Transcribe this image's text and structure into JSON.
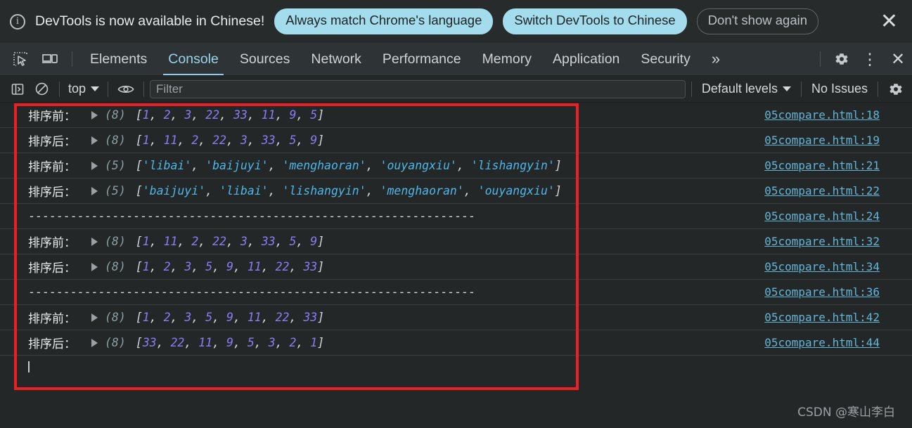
{
  "banner": {
    "info_icon": "info-icon",
    "message": "DevTools is now available in Chinese!",
    "primary_button": "Always match Chrome's language",
    "secondary_button": "Switch DevTools to Chinese",
    "dismiss_button": "Don't show again",
    "close_icon": "✕",
    "accent_color": "#a3dcec"
  },
  "tabbar": {
    "inspect_icon": "inspect-element-icon",
    "device_icon": "device-toolbar-icon",
    "tabs": [
      {
        "label": "Elements",
        "active": false
      },
      {
        "label": "Console",
        "active": true
      },
      {
        "label": "Sources",
        "active": false
      },
      {
        "label": "Network",
        "active": false
      },
      {
        "label": "Performance",
        "active": false
      },
      {
        "label": "Memory",
        "active": false
      },
      {
        "label": "Application",
        "active": false
      },
      {
        "label": "Security",
        "active": false
      }
    ],
    "more_tabs_icon": "»",
    "settings_icon": "gear-icon",
    "menu_icon": "⋮",
    "close_icon": "✕",
    "active_tab_color": "#9ad4ec"
  },
  "console_toolbar": {
    "sidebar_toggle_icon": "sidebar-toggle-icon",
    "clear_console_icon": "clear-console-icon",
    "context": "top",
    "eye_icon": "live-expression-icon",
    "filter_placeholder": "Filter",
    "filter_value": "",
    "levels": "Default levels",
    "issues": "No Issues",
    "settings_icon": "gear-icon"
  },
  "console_rows": [
    {
      "label": "排序前：",
      "type": "array",
      "length": "(8)",
      "items": [
        "1",
        "2",
        "3",
        "22",
        "33",
        "11",
        "9",
        "5"
      ],
      "item_type": "num",
      "source": "05compare.html:18"
    },
    {
      "label": "排序后：",
      "type": "array",
      "length": "(8)",
      "items": [
        "1",
        "11",
        "2",
        "22",
        "3",
        "33",
        "5",
        "9"
      ],
      "item_type": "num",
      "source": "05compare.html:19"
    },
    {
      "label": "排序前：",
      "type": "array",
      "length": "(5)",
      "items": [
        "'libai'",
        "'baijuyi'",
        "'menghaoran'",
        "'ouyangxiu'",
        "'lishangyin'"
      ],
      "item_type": "str",
      "source": "05compare.html:21"
    },
    {
      "label": "排序后：",
      "type": "array",
      "length": "(5)",
      "items": [
        "'baijuyi'",
        "'libai'",
        "'lishangyin'",
        "'menghaoran'",
        "'ouyangxiu'"
      ],
      "item_type": "str",
      "source": "05compare.html:22"
    },
    {
      "label": "",
      "type": "text",
      "text": "----------------------------------------------------------------",
      "source": "05compare.html:24"
    },
    {
      "label": "排序前：",
      "type": "array",
      "length": "(8)",
      "items": [
        "1",
        "11",
        "2",
        "22",
        "3",
        "33",
        "5",
        "9"
      ],
      "item_type": "num",
      "source": "05compare.html:32"
    },
    {
      "label": "排序后：",
      "type": "array",
      "length": "(8)",
      "items": [
        "1",
        "2",
        "3",
        "5",
        "9",
        "11",
        "22",
        "33"
      ],
      "item_type": "num",
      "source": "05compare.html:34"
    },
    {
      "label": "",
      "type": "text",
      "text": "----------------------------------------------------------------",
      "source": "05compare.html:36"
    },
    {
      "label": "排序前：",
      "type": "array",
      "length": "(8)",
      "items": [
        "1",
        "2",
        "3",
        "5",
        "9",
        "11",
        "22",
        "33"
      ],
      "item_type": "num",
      "source": "05compare.html:42"
    },
    {
      "label": "排序后：",
      "type": "array",
      "length": "(8)",
      "items": [
        "33",
        "22",
        "11",
        "9",
        "5",
        "3",
        "2",
        "1"
      ],
      "item_type": "num",
      "source": "05compare.html:44"
    }
  ],
  "annotation": {
    "color": "#ec2024"
  },
  "watermark": "CSDN @寒山李白"
}
